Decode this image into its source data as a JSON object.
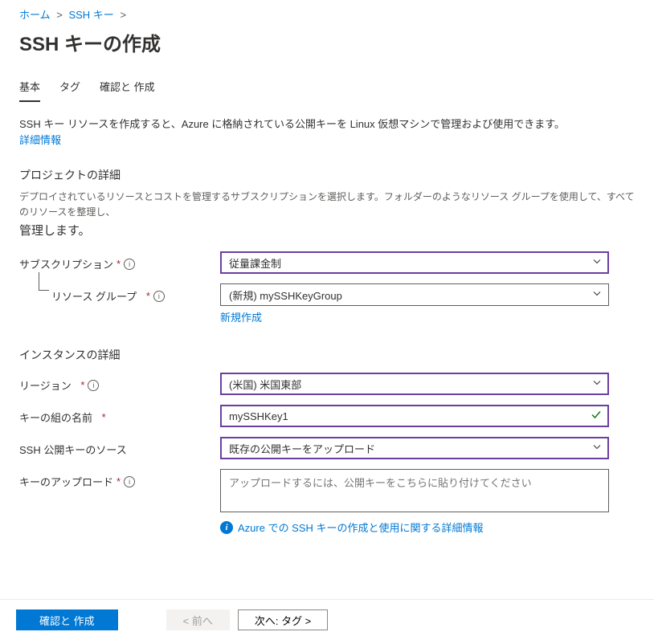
{
  "breadcrumb": {
    "home": "ホーム",
    "sshkey": "SSH キー"
  },
  "page_title": "SSH キーの作成",
  "tabs": {
    "basic": "基本",
    "tag": "タグ",
    "review": "確認と 作成"
  },
  "intro": {
    "text": "SSH キー リソースを作成すると、Azure に格納されている公開キーを Linux 仮想マシンで管理および使用できます。",
    "link": "詳細情報"
  },
  "project_section": {
    "header": "プロジェクトの詳細",
    "desc_small": "デプロイされているリソースとコストを管理するサブスクリプションを選択します。フォルダーのようなリソース グループを使用して、すべてのリソースを整理し、",
    "desc_large": "管理します。"
  },
  "fields": {
    "subscription": {
      "label": "サブスクリプション",
      "value": "従量課金制"
    },
    "resource_group": {
      "label": "リソース グループ",
      "value": "(新規) mySSHKeyGroup",
      "create_new": "新規作成"
    }
  },
  "instance_section": {
    "header": "インスタンスの詳細"
  },
  "instance_fields": {
    "region": {
      "label": "リージョン",
      "value": "(米国) 米国東部"
    },
    "keypair_name": {
      "label": "キーの組の名前",
      "value": "mySSHKey1"
    },
    "key_source": {
      "label": "SSH 公開キーのソース",
      "value": "既存の公開キーをアップロード"
    },
    "key_upload": {
      "label": "キーのアップロード",
      "placeholder": "アップロードするには、公開キーをこちらに貼り付けてください"
    },
    "info_link": "Azure での SSH キーの作成と使用に関する詳細情報"
  },
  "footer": {
    "review_create": "確認と 作成",
    "prev": "< 前へ",
    "next": "次へ: タグ >"
  }
}
